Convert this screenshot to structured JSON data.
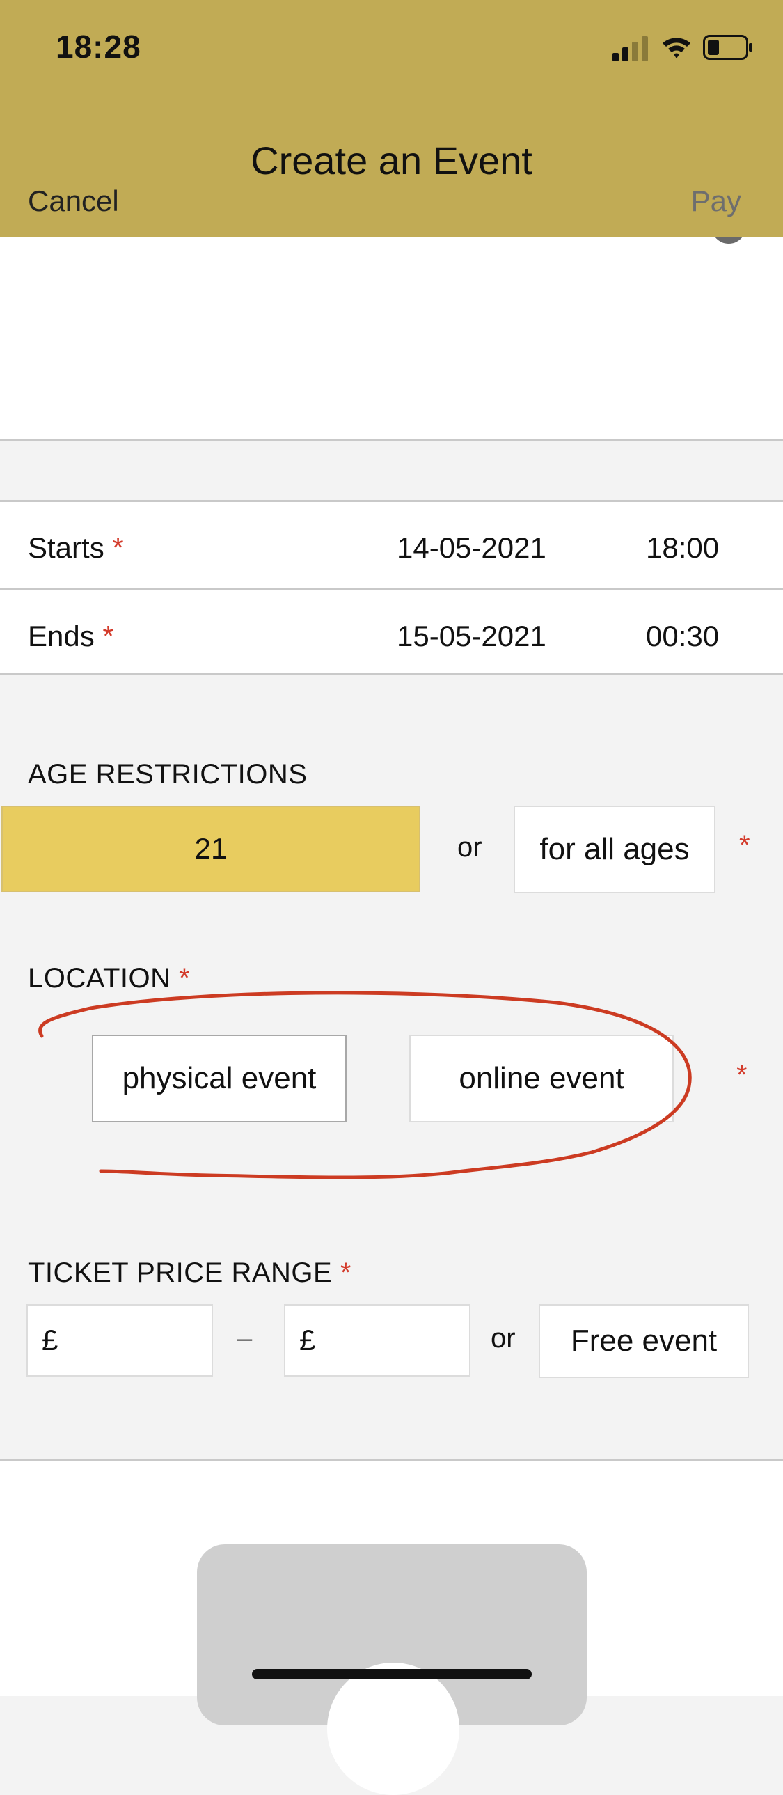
{
  "status_bar": {
    "time": "18:28"
  },
  "nav": {
    "title": "Create an Event",
    "cancel_label": "Cancel",
    "pay_label": "Pay"
  },
  "schedule": {
    "starts": {
      "label": "Starts",
      "required": "*",
      "date": "14-05-2021",
      "time": "18:00"
    },
    "ends": {
      "label": "Ends",
      "required": "*",
      "date": "15-05-2021",
      "time": "00:30"
    }
  },
  "age": {
    "label": "AGE RESTRICTIONS",
    "selected_value": "21",
    "or_text": "or",
    "all_ages_label": "for all ages",
    "required": "*"
  },
  "location": {
    "label": "LOCATION",
    "required": "*",
    "physical_label": "physical event",
    "online_label": "online event",
    "row_required": "*"
  },
  "price": {
    "label": "TICKET PRICE RANGE",
    "required": "*",
    "min_prefix": "£",
    "dash": "–",
    "max_prefix": "£",
    "or_text": "or",
    "free_label": "Free event"
  },
  "colors": {
    "header": "#c1ab55",
    "selected": "#e8cc5f",
    "required": "#d33a2a",
    "annotation": "#cc3b22"
  }
}
